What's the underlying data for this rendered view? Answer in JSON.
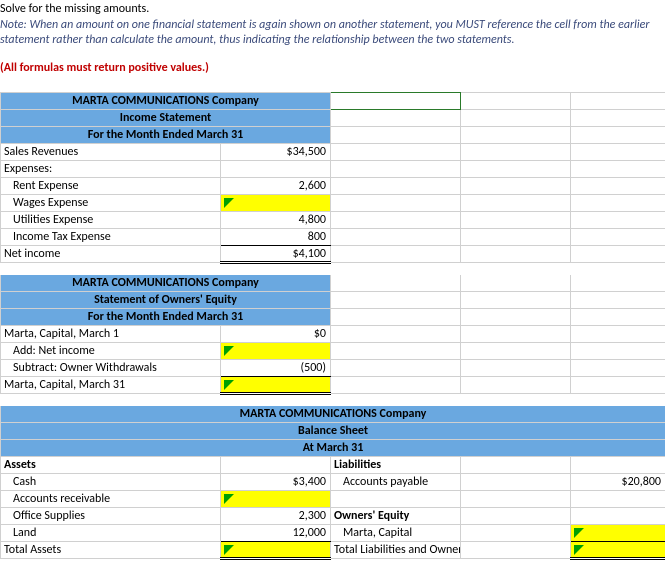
{
  "instructions": {
    "line1": "Solve for the missing amounts.",
    "note": "Note:  When an amount on one financial statement is again shown on  another statement, you MUST reference the cell from the earlier statement rather than calculate the amount, thus  indicating the relationship between the two statements.",
    "red": "(All formulas must return positive values.)"
  },
  "income": {
    "title1": "MARTA COMMUNICATIONS Company",
    "title2": "Income Statement",
    "title3": "For the Month Ended  March 31",
    "rows": {
      "sales_rev": "Sales Revenues",
      "sales_rev_val": "$34,500",
      "expenses": "Expenses:",
      "rent": "Rent Expense",
      "rent_val": "2,600",
      "wages": "Wages Expense",
      "util": "Utilities Expense",
      "util_val": "4,800",
      "tax": "Income Tax Expense",
      "tax_val": "800",
      "net": "Net income",
      "net_val": "$4,100"
    }
  },
  "equity": {
    "title1": "MARTA COMMUNICATIONS Company",
    "title2": "Statement of Owners' Equity",
    "title3": "For the Month Ended  March 31",
    "rows": {
      "cap_begin": "Marta, Capital, March 1",
      "cap_begin_val": "$0",
      "add_net": "Add: Net income",
      "withdraw": "Subtract: Owner Withdrawals",
      "withdraw_val": "(500)",
      "cap_end": "Marta, Capital, March 31"
    }
  },
  "balance": {
    "title1": "MARTA COMMUNICATIONS Company",
    "title2": "Balance Sheet",
    "title3": "At March 31",
    "assets_hdr": "Assets",
    "liab_hdr": "Liabilities",
    "cash": "Cash",
    "cash_val": "$3,400",
    "ap": "Accounts payable",
    "ap_val": "$20,800",
    "ar": "Accounts receivable",
    "supplies": "Office Supplies",
    "supplies_val": "2,300",
    "oe_hdr": "Owners' Equity",
    "land": "Land",
    "land_val": "12,000",
    "marta_cap": "Marta, Capital",
    "total_assets": "Total Assets",
    "total_le": "Total Liabilities and Owners' Equity"
  }
}
